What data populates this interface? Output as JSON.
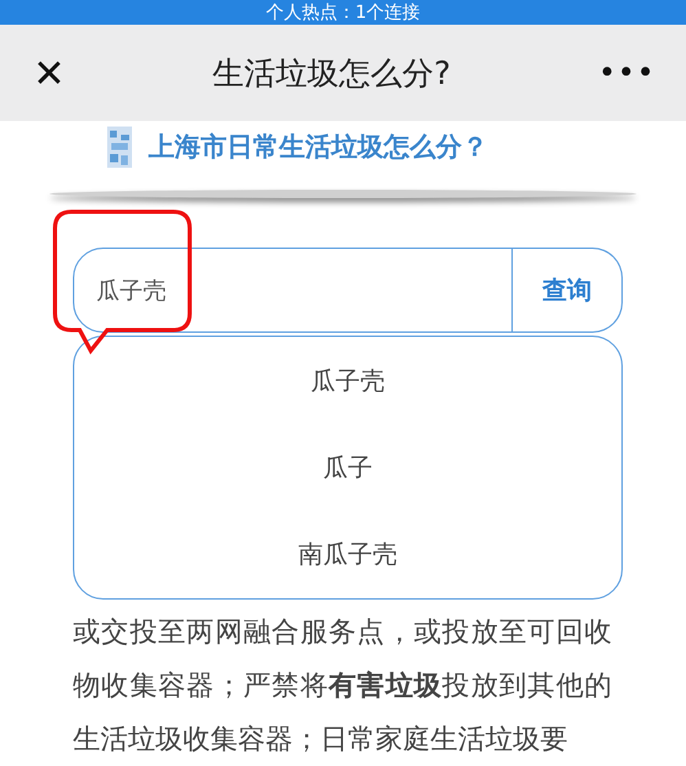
{
  "status_bar": {
    "text": "个人热点：1个连接"
  },
  "nav": {
    "title": "生活垃圾怎么分?",
    "close": "✕",
    "more": "•••"
  },
  "headline": "上海市日常生活垃圾怎么分？",
  "search": {
    "value": "瓜子壳",
    "button": "查询"
  },
  "suggestions": [
    "瓜子壳",
    "瓜子",
    "南瓜子壳"
  ],
  "paragraph": "或交投至两网融合服务点，或投放至可回收物收集容器；严禁将**有害垃圾**投放到其他的生活垃圾收集容器；日常家庭生活垃圾要"
}
